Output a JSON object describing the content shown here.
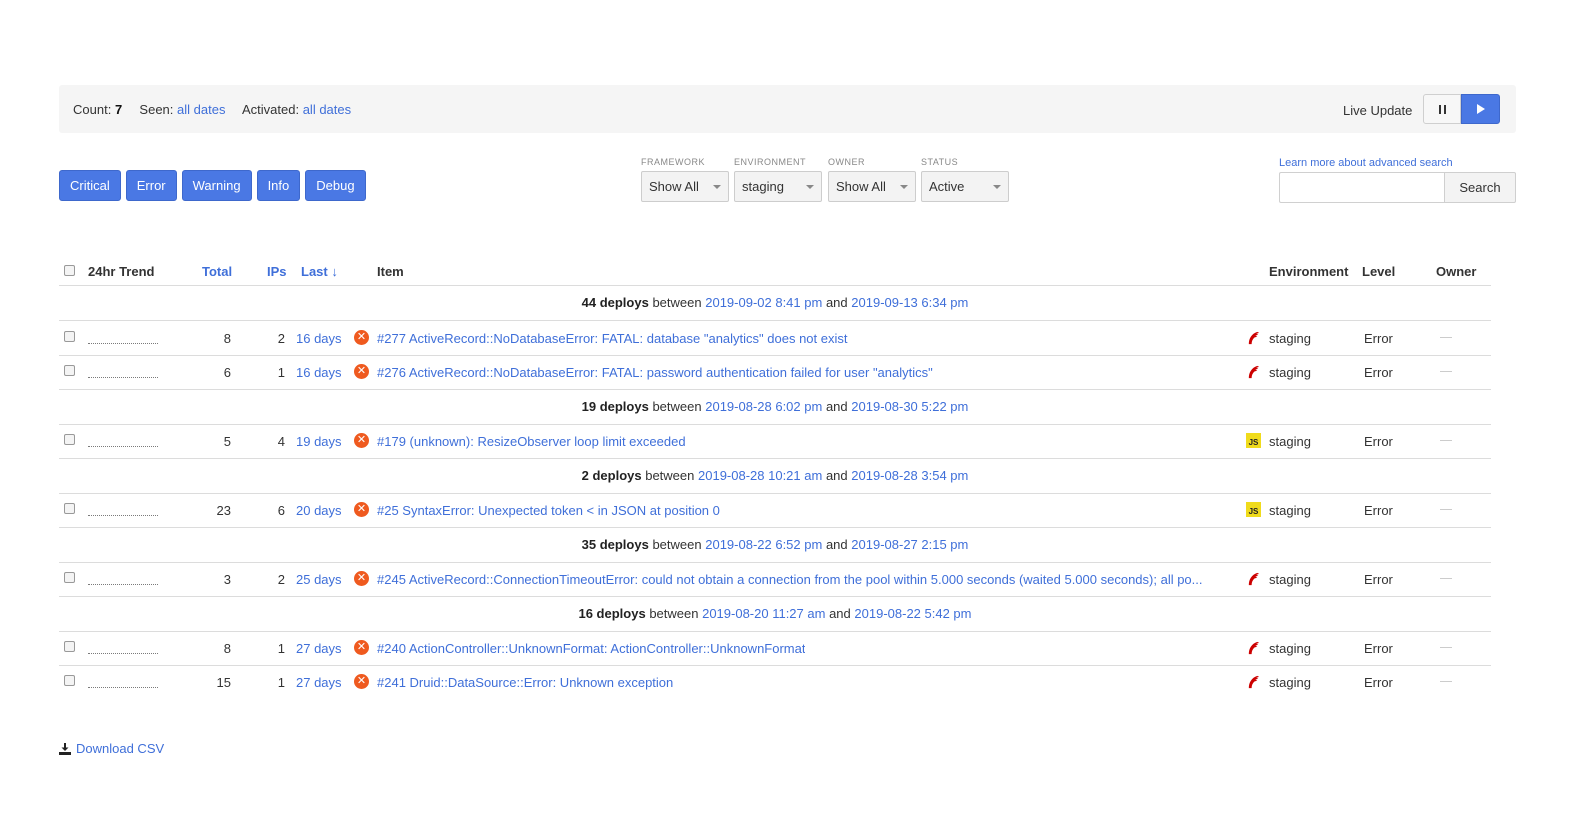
{
  "summary": {
    "count_label": "Count:",
    "count_value": "7",
    "seen_label": "Seen:",
    "seen_value": "all dates",
    "activated_label": "Activated:",
    "activated_value": "all dates"
  },
  "live_update": {
    "label": "Live Update"
  },
  "levels": [
    "Critical",
    "Error",
    "Warning",
    "Info",
    "Debug"
  ],
  "filters": {
    "framework": {
      "label": "FRAMEWORK",
      "value": "Show All"
    },
    "environment": {
      "label": "ENVIRONMENT",
      "value": "staging"
    },
    "owner": {
      "label": "OWNER",
      "value": "Show All"
    },
    "status": {
      "label": "STATUS",
      "value": "Active"
    }
  },
  "search": {
    "advanced_link": "Learn more about advanced search",
    "placeholder": "",
    "button": "Search"
  },
  "table": {
    "headers": {
      "trend": "24hr Trend",
      "total": "Total",
      "ips": "IPs",
      "last": "Last",
      "item": "Item",
      "environment": "Environment",
      "level": "Level",
      "owner": "Owner"
    },
    "deploys": [
      {
        "count": "44 deploys",
        "between": "between",
        "from": "2019-09-02 8:41 pm",
        "and": "and",
        "to": "2019-09-13 6:34 pm"
      },
      {
        "count": "19 deploys",
        "between": "between",
        "from": "2019-08-28 6:02 pm",
        "and": "and",
        "to": "2019-08-30 5:22 pm"
      },
      {
        "count": "2 deploys",
        "between": "between",
        "from": "2019-08-28 10:21 am",
        "and": "and",
        "to": "2019-08-28 3:54 pm"
      },
      {
        "count": "35 deploys",
        "between": "between",
        "from": "2019-08-22 6:52 pm",
        "and": "and",
        "to": "2019-08-27 2:15 pm"
      },
      {
        "count": "16 deploys",
        "between": "between",
        "from": "2019-08-20 11:27 am",
        "and": "and",
        "to": "2019-08-22 5:42 pm"
      }
    ],
    "rows": [
      {
        "total": "8",
        "ips": "2",
        "last": "16 days",
        "title": "#277 ActiveRecord::NoDatabaseError: FATAL: database \"analytics\" does not exist",
        "framework": "rails",
        "environment": "staging",
        "level": "Error"
      },
      {
        "total": "6",
        "ips": "1",
        "last": "16 days",
        "title": "#276 ActiveRecord::NoDatabaseError: FATAL: password authentication failed for user \"analytics\"",
        "framework": "rails",
        "environment": "staging",
        "level": "Error"
      },
      {
        "total": "5",
        "ips": "4",
        "last": "19 days",
        "title": "#179 (unknown): ResizeObserver loop limit exceeded",
        "framework": "js",
        "framework_badge": "JS",
        "environment": "staging",
        "level": "Error"
      },
      {
        "total": "23",
        "ips": "6",
        "last": "20 days",
        "title": "#25 SyntaxError: Unexpected token < in JSON at position 0",
        "framework": "js",
        "framework_badge": "JS",
        "environment": "staging",
        "level": "Error"
      },
      {
        "total": "3",
        "ips": "2",
        "last": "25 days",
        "title": "#245 ActiveRecord::ConnectionTimeoutError: could not obtain a connection from the pool within 5.000 seconds (waited 5.000 seconds); all po...",
        "framework": "rails",
        "environment": "staging",
        "level": "Error"
      },
      {
        "total": "8",
        "ips": "1",
        "last": "27 days",
        "title": "#240 ActionController::UnknownFormat: ActionController::UnknownFormat",
        "framework": "rails",
        "environment": "staging",
        "level": "Error"
      },
      {
        "total": "15",
        "ips": "1",
        "last": "27 days",
        "title": "#241 Druid::DataSource::Error: Unknown exception",
        "framework": "rails",
        "environment": "staging",
        "level": "Error"
      }
    ]
  },
  "download": {
    "label": "Download CSV"
  },
  "colors": {
    "accent": "#4a78e4",
    "link": "#3f6fd9",
    "error_icon": "#ef5a1f",
    "rails_icon": "#cc0000",
    "js_badge": "#f0db1c"
  }
}
